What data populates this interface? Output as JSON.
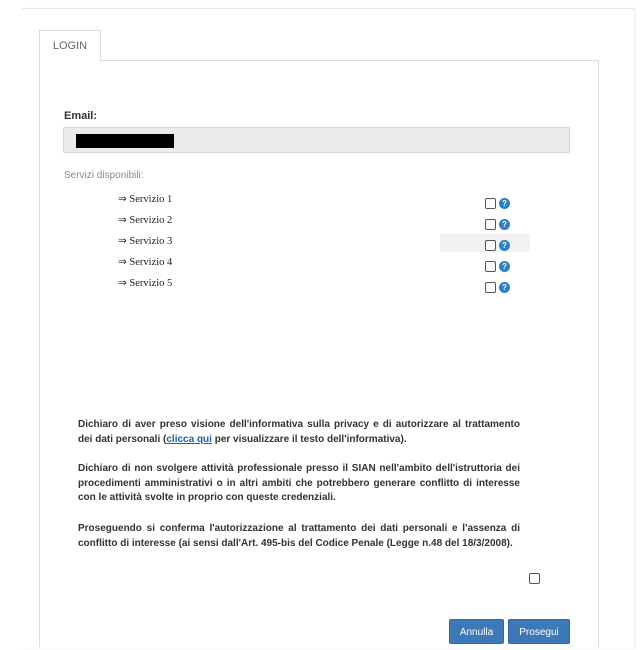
{
  "tab": {
    "label": "LOGIN"
  },
  "email": {
    "label": "Email:",
    "value": ""
  },
  "services": {
    "label": "Servizi disponibili:",
    "items": [
      {
        "label": "⇒ Servizio 1"
      },
      {
        "label": "⇒ Servizio 2"
      },
      {
        "label": "⇒ Servizio 3"
      },
      {
        "label": "⇒ Servizio 4"
      },
      {
        "label": "⇒ Servizio 5"
      }
    ]
  },
  "disclaimer": {
    "privacy_before": "Dichiaro di aver preso visione dell'informativa sulla privacy e di autorizzare al trattamento dei dati personali (",
    "privacy_link": "clicca qui",
    "privacy_after": " per visualizzare il testo dell'informativa).",
    "conflict": "Dichiaro di non svolgere attività professionale presso il SIAN nell'ambito dell'istruttoria dei procedimenti amministrativi o in altri ambiti che potrebbero generare conflitto di interesse con le attività svolte in proprio con queste credenziali.",
    "consent": "Proseguendo si conferma l'autorizzazione al trattamento dei dati personali e l'assenza di conflitto di interesse (ai sensi dall'Art. 495-bis del Codice Penale (Legge n.48 del 18/3/2008)."
  },
  "buttons": {
    "cancel": "Annulla",
    "proceed": "Prosegui"
  },
  "colors": {
    "button": "#3d79b6",
    "help_icon": "#2e7fc9",
    "link": "#1a5fb4"
  },
  "icons": {
    "help": "question-circle-icon"
  }
}
